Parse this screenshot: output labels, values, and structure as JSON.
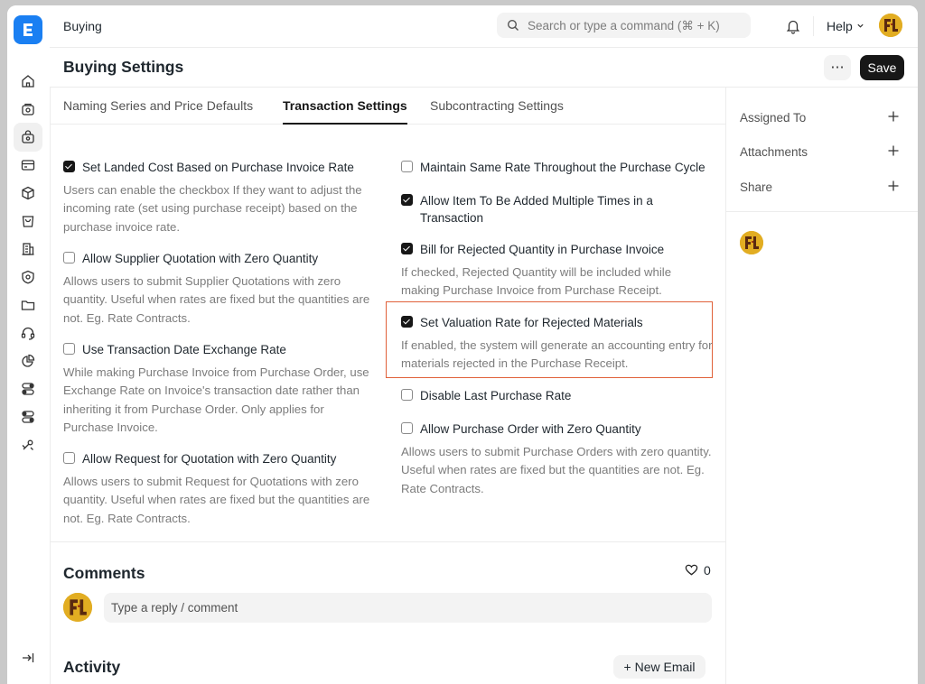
{
  "navbar": {
    "title": "Buying",
    "search_placeholder": "Search or type a command (⌘ + K)",
    "help_label": "Help"
  },
  "rail": {
    "icons": [
      "home-icon",
      "orders-icon",
      "buying-icon",
      "invoice-icon",
      "stock-icon",
      "selling-icon",
      "building-icon",
      "shield-icon",
      "folder-icon",
      "support-icon",
      "pie-chart-icon",
      "toggle-icon",
      "toggle-icon",
      "tools-icon"
    ],
    "collapse_icon": "sidebar-collapse-icon"
  },
  "page": {
    "title": "Buying Settings",
    "more_label": "···",
    "save_label": "Save"
  },
  "tabs": [
    {
      "label": "Naming Series and Price Defaults",
      "active": false
    },
    {
      "label": "Transaction Settings",
      "active": true
    },
    {
      "label": "Subcontracting Settings",
      "active": false
    }
  ],
  "left_fields": [
    {
      "label": "Set Landed Cost Based on Purchase Invoice Rate",
      "checked": true,
      "description": "Users can enable the checkbox If they want to adjust the incoming rate (set using purchase receipt) based on the purchase invoice rate."
    },
    {
      "label": "Allow Supplier Quotation with Zero Quantity",
      "checked": false,
      "description": "Allows users to submit Supplier Quotations with zero quantity. Useful when rates are fixed but the quantities are not. Eg. Rate Contracts."
    },
    {
      "label": "Use Transaction Date Exchange Rate",
      "checked": false,
      "description": "While making Purchase Invoice from Purchase Order, use Exchange Rate on Invoice's transaction date rather than inheriting it from Purchase Order. Only applies for Purchase Invoice."
    },
    {
      "label": "Allow Request for Quotation with Zero Quantity",
      "checked": false,
      "description": "Allows users to submit Request for Quotations with zero quantity. Useful when rates are fixed but the quantities are not. Eg. Rate Contracts."
    }
  ],
  "right_fields": [
    {
      "label": "Maintain Same Rate Throughout the Purchase Cycle",
      "checked": false,
      "description": ""
    },
    {
      "label": "Allow Item To Be Added Multiple Times in a Transaction",
      "checked": true,
      "description": ""
    },
    {
      "label": "Bill for Rejected Quantity in Purchase Invoice",
      "checked": true,
      "description": "If checked, Rejected Quantity will be included while making Purchase Invoice from Purchase Receipt."
    },
    {
      "label": "Set Valuation Rate for Rejected Materials",
      "checked": true,
      "description": "If enabled, the system will generate an accounting entry for materials rejected in the Purchase Receipt."
    },
    {
      "label": "Disable Last Purchase Rate",
      "checked": false,
      "description": ""
    },
    {
      "label": "Allow Purchase Order with Zero Quantity",
      "checked": false,
      "description": "Allows users to submit Purchase Orders with zero quantity. Useful when rates are fixed but the quantities are not. Eg. Rate Contracts."
    }
  ],
  "highlight_color": "#e0613a",
  "comments": {
    "title": "Comments",
    "like_count": "0",
    "placeholder": "Type a reply / comment"
  },
  "activity": {
    "title": "Activity",
    "new_email_label": "+ New Email"
  },
  "sidebar": {
    "assigned_to": "Assigned To",
    "attachments": "Attachments",
    "share": "Share"
  }
}
